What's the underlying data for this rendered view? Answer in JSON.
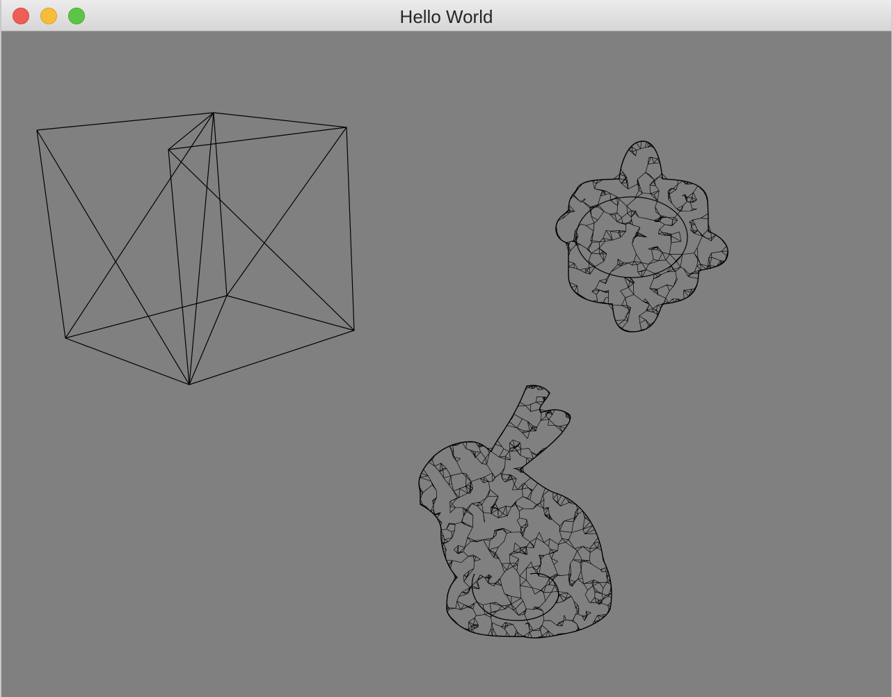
{
  "window": {
    "title": "Hello World",
    "buttons": {
      "close": "close-button",
      "minimize": "minimize-button",
      "zoom": "zoom-button"
    }
  },
  "scene": {
    "background_color": "#808080",
    "wire_color": "#000000",
    "objects": [
      {
        "name": "cube",
        "render_mode": "wireframe"
      },
      {
        "name": "spiky-sphere",
        "render_mode": "wireframe"
      },
      {
        "name": "bunny",
        "render_mode": "wireframe"
      }
    ]
  }
}
